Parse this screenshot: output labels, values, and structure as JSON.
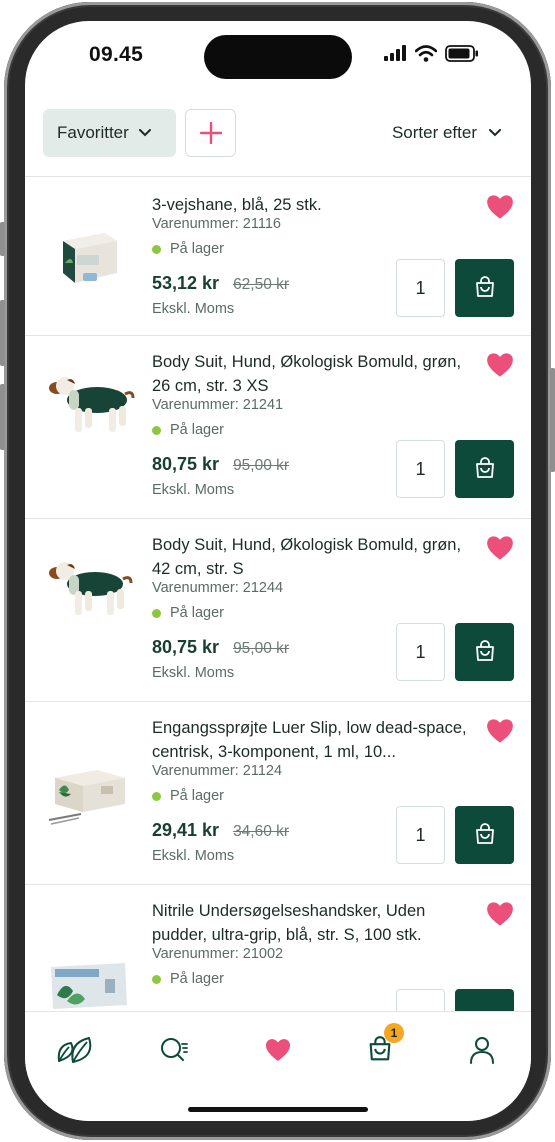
{
  "status_bar": {
    "time": "09.45"
  },
  "toolbar": {
    "favorites_label": "Favoritter",
    "sort_label": "Sorter efter"
  },
  "colors": {
    "brand_green": "#0e4a3a",
    "heart_pink": "#ec4f79",
    "stock_green": "#8dc63f",
    "badge_orange": "#f5a623"
  },
  "products": [
    {
      "title": "3-vejshane, blå, 25 stk.",
      "sku": "Varenummer: 21116",
      "stock": "På lager",
      "price": "53,12 kr",
      "old_price": "62,50 kr",
      "vat": "Ekskl. Moms",
      "qty": "1"
    },
    {
      "title": "Body Suit, Hund, Økologisk Bomuld, grøn, 26 cm, str. 3 XS",
      "sku": "Varenummer: 21241",
      "stock": "På lager",
      "price": "80,75 kr",
      "old_price": "95,00 kr",
      "vat": "Ekskl. Moms",
      "qty": "1"
    },
    {
      "title": "Body Suit, Hund, Økologisk Bomuld, grøn, 42 cm, str. S",
      "sku": "Varenummer: 21244",
      "stock": "På lager",
      "price": "80,75 kr",
      "old_price": "95,00 kr",
      "vat": "Ekskl. Moms",
      "qty": "1"
    },
    {
      "title": "Engangssprøjte Luer Slip, low dead-space, centrisk, 3-komponent, 1 ml, 10...",
      "sku": "Varenummer: 21124",
      "stock": "På lager",
      "price": "29,41 kr",
      "old_price": "34,60 kr",
      "vat": "Ekskl. Moms",
      "qty": "1"
    },
    {
      "title": "Nitrile Undersøgelseshandsker, Uden pudder, ultra-grip, blå, str. S, 100 stk.",
      "sku": "Varenummer: 21002",
      "stock": "På lager",
      "price": "",
      "old_price": "",
      "vat": "",
      "qty": ""
    }
  ],
  "bottom_nav": {
    "items": [
      "home-leaf-icon",
      "search-icon",
      "heart-icon",
      "cart-icon",
      "user-icon"
    ],
    "cart_badge": "1"
  }
}
